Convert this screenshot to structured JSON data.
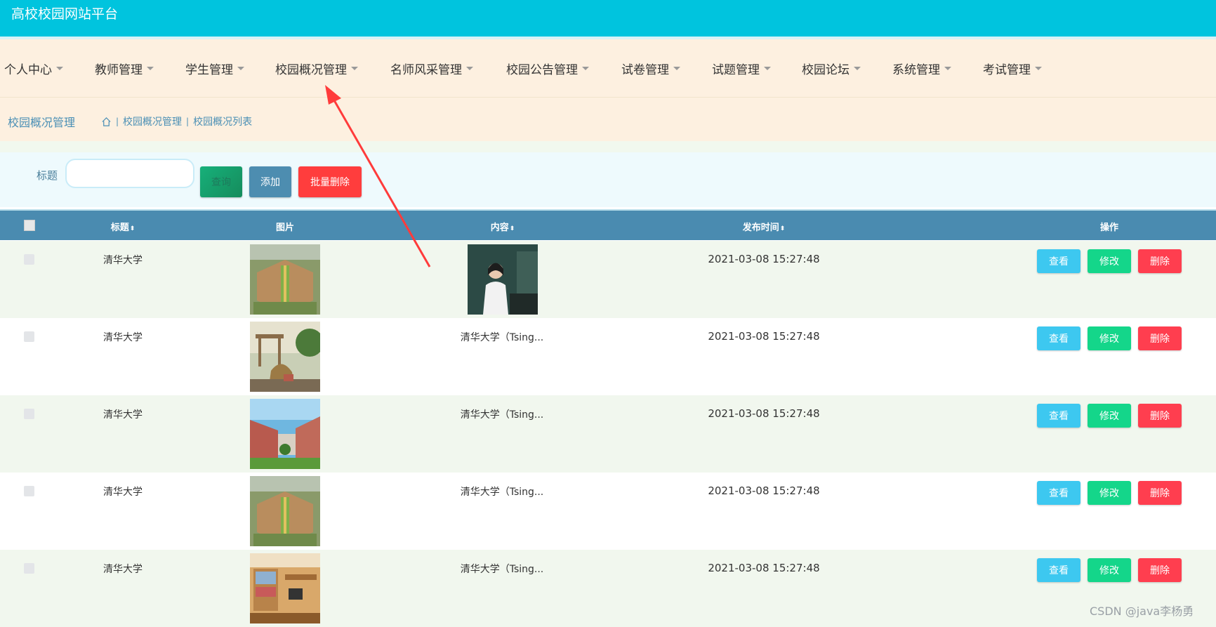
{
  "app": {
    "title": "高校校园网站平台"
  },
  "nav": {
    "items": [
      "个人中心",
      "教师管理",
      "学生管理",
      "校园概况管理",
      "名师风采管理",
      "校园公告管理",
      "试卷管理",
      "试题管理",
      "校园论坛",
      "系统管理",
      "考试管理"
    ]
  },
  "breadcrumb": {
    "title": "校园概况管理",
    "path": [
      "校园概况管理",
      "校园概况列表"
    ]
  },
  "search": {
    "label": "标题",
    "query_button": "查询",
    "add_button": "添加",
    "batch_delete_button": "批量删除"
  },
  "table": {
    "headers": {
      "title": "标题",
      "image": "图片",
      "content": "内容",
      "time": "发布时间",
      "actions": "操作"
    },
    "sort_glyph": "⬍",
    "rows": [
      {
        "title": "清华大学",
        "content": "",
        "time": "2021-03-08 15:27:48",
        "view": "查看",
        "edit": "修改",
        "delete": "删除"
      },
      {
        "title": "清华大学",
        "content": "清华大学（Tsing...",
        "time": "2021-03-08 15:27:48",
        "view": "查看",
        "edit": "修改",
        "delete": "删除"
      },
      {
        "title": "清华大学",
        "content": "清华大学（Tsing...",
        "time": "2021-03-08 15:27:48",
        "view": "查看",
        "edit": "修改",
        "delete": "删除"
      },
      {
        "title": "清华大学",
        "content": "清华大学（Tsing...",
        "time": "2021-03-08 15:27:48",
        "view": "查看",
        "edit": "修改",
        "delete": "删除"
      },
      {
        "title": "清华大学",
        "content": "清华大学（Tsing...",
        "time": "2021-03-08 15:27:48",
        "view": "查看",
        "edit": "修改",
        "delete": "删除"
      }
    ]
  },
  "watermark": "CSDN @java李杨勇",
  "colors": {
    "topbar": "#00c4de",
    "nav_bg": "#fdf0e0",
    "header_bg": "#4a8bb0",
    "view": "#3dc8f0",
    "edit": "#14d68a",
    "delete": "#ff3e4f",
    "arrow": "#ff3b3b"
  }
}
